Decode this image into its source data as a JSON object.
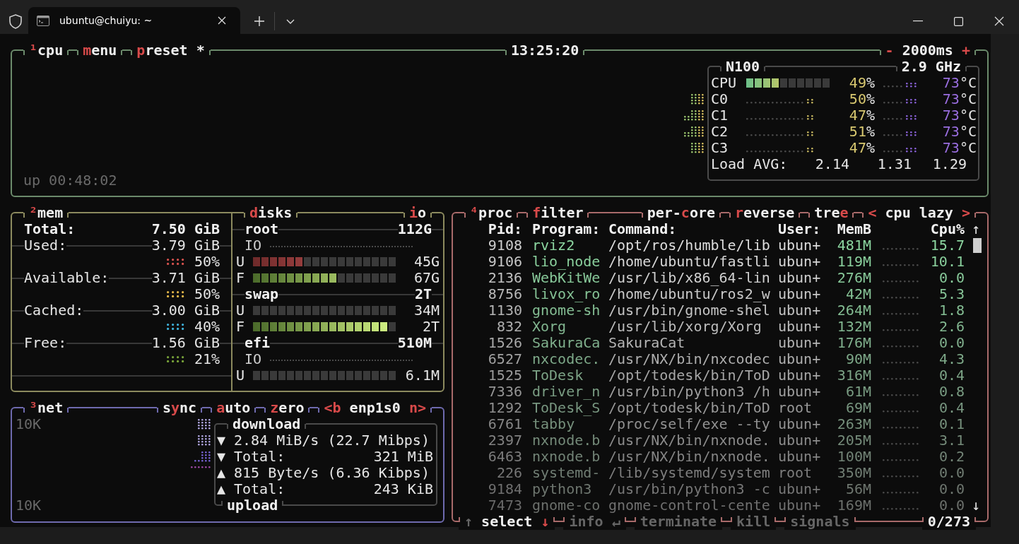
{
  "window": {
    "tab_title": "ubuntu@chuiyu: ~"
  },
  "cpu": {
    "header": {
      "left": [
        {
          "parts": [
            {
              "text": "¹",
              "hot": true
            },
            {
              "text": "cpu",
              "hot": false
            }
          ]
        },
        {
          "parts": [
            {
              "text": "m",
              "hot": true
            },
            {
              "text": "enu",
              "hot": false
            }
          ]
        },
        {
          "parts": [
            {
              "text": "p",
              "hot": true
            },
            {
              "text": "reset *",
              "hot": false
            }
          ]
        }
      ],
      "center": [
        {
          "parts": [
            {
              "text": "13:25:20",
              "hot": false
            }
          ]
        }
      ],
      "right": [
        {
          "parts": [
            {
              "text": "-",
              "hot": true
            },
            {
              "text": " 2000ms ",
              "hot": false
            },
            {
              "text": "+",
              "hot": true
            }
          ]
        }
      ]
    },
    "uptime": "up 00:48:02",
    "info_header": {
      "left": [
        {
          "parts": [
            {
              "text": "N100",
              "hot": false
            }
          ]
        }
      ],
      "right": [
        {
          "parts": [
            {
              "text": "2.9 GHz",
              "hot": false
            }
          ]
        }
      ]
    },
    "total": {
      "label": "CPU",
      "level": 0.4,
      "usage": [
        "49",
        "%"
      ],
      "temp": [
        "73",
        "°C"
      ]
    },
    "cores": [
      {
        "label": "C0",
        "usage": [
          "50",
          "%"
        ],
        "temp": [
          "73",
          "°C"
        ]
      },
      {
        "label": "C1",
        "usage": [
          "47",
          "%"
        ],
        "temp": [
          "73",
          "°C"
        ]
      },
      {
        "label": "C2",
        "usage": [
          "51",
          "%"
        ],
        "temp": [
          "73",
          "°C"
        ]
      },
      {
        "label": "C3",
        "usage": [
          "47",
          "%"
        ],
        "temp": [
          "73",
          "°C"
        ]
      }
    ],
    "load": {
      "label": "Load AVG:",
      "values": [
        "2.14",
        "1.31",
        "1.29"
      ]
    }
  },
  "mem": {
    "header": {
      "left": [
        {
          "parts": [
            {
              "text": "²",
              "hot": true
            },
            {
              "text": "mem",
              "hot": false
            }
          ]
        }
      ]
    },
    "total": {
      "label": "Total:",
      "value": "7.50 GiB"
    },
    "items": [
      {
        "label": "Used:",
        "value": "3.79 GiB",
        "percent": "50%",
        "color": "#d9534f"
      },
      {
        "label": "Available:",
        "value": "3.71 GiB",
        "percent": "50%",
        "color": "#e5b84a"
      },
      {
        "label": "Cached:",
        "value": "3.00 GiB",
        "percent": "40%",
        "color": "#3fb3dc"
      },
      {
        "label": "Free:",
        "value": "1.56 GiB",
        "percent": "21%",
        "color": "#7aa53a"
      }
    ]
  },
  "disks": {
    "header": {
      "left": [
        {
          "parts": [
            {
              "text": "d",
              "hot": true
            },
            {
              "text": "isks",
              "hot": false
            }
          ]
        }
      ],
      "right": [
        {
          "parts": [
            {
              "text": "i",
              "hot": true
            },
            {
              "text": "o",
              "hot": false
            }
          ]
        }
      ]
    },
    "volumes": [
      {
        "name": "root",
        "size": "112G",
        "rows": [
          {
            "kind": "io",
            "label": "IO"
          },
          {
            "kind": "used",
            "label": "U",
            "level": 0.353,
            "value": "45G"
          },
          {
            "kind": "free",
            "label": "F",
            "level": 0.588,
            "value": "67G"
          }
        ]
      },
      {
        "name": "swap",
        "size": "2T",
        "rows": [
          {
            "kind": "used",
            "label": "U",
            "value": "34M"
          },
          {
            "kind": "free",
            "label": "F",
            "level": 0.941,
            "value": "2T"
          }
        ]
      },
      {
        "name": "efi",
        "size": "510M",
        "rows": [
          {
            "kind": "io",
            "label": "IO"
          },
          {
            "kind": "used",
            "label": "U",
            "value": "6.1M"
          }
        ]
      }
    ]
  },
  "net": {
    "header": {
      "left": [
        {
          "parts": [
            {
              "text": "³",
              "hot": true
            },
            {
              "text": "net",
              "hot": false
            }
          ]
        }
      ],
      "right": [
        {
          "parts": [
            {
              "text": "s",
              "hot": false
            },
            {
              "text": "y",
              "hot": true
            },
            {
              "text": "nc",
              "hot": false
            }
          ]
        },
        {
          "parts": [
            {
              "text": "a",
              "hot": true
            },
            {
              "text": "uto",
              "hot": false
            }
          ]
        },
        {
          "parts": [
            {
              "text": "z",
              "hot": true
            },
            {
              "text": "ero",
              "hot": false
            }
          ]
        },
        {
          "parts": [
            {
              "text": "<b",
              "hot": true
            },
            {
              "text": " enp1s0 ",
              "hot": false
            },
            {
              "text": "n>",
              "hot": true
            }
          ]
        }
      ]
    },
    "scale_top": "10K",
    "scale_bottom": "10K",
    "stats_header": {
      "left": [
        {
          "parts": [
            {
              "text": "download",
              "hot": false
            }
          ]
        }
      ]
    },
    "stats_footer": {
      "left": [
        {
          "parts": [
            {
              "text": "upload",
              "hot": false
            }
          ]
        }
      ]
    },
    "stats": [
      {
        "arrow": "▼",
        "text": "2.84 MiB/s (22.7 Mibps)"
      },
      {
        "arrow": "▼",
        "text": "Total:",
        "value": "321 MiB"
      },
      {
        "arrow": "▲",
        "text": "815 Byte/s (6.36 Kibps)"
      },
      {
        "arrow": "▲",
        "text": "Total:",
        "value": "243 KiB"
      }
    ]
  },
  "proc": {
    "header": {
      "left": [
        {
          "parts": [
            {
              "text": "⁴",
              "hot": true
            },
            {
              "text": "proc",
              "hot": false
            }
          ]
        },
        {
          "parts": [
            {
              "text": "f",
              "hot": true
            },
            {
              "text": "ilter",
              "hot": false
            }
          ]
        }
      ],
      "right": [
        {
          "parts": [
            {
              "text": "per-",
              "hot": false
            },
            {
              "text": "c",
              "hot": true
            },
            {
              "text": "ore",
              "hot": false
            }
          ]
        },
        {
          "parts": [
            {
              "text": "r",
              "hot": true
            },
            {
              "text": "everse",
              "hot": false
            }
          ]
        },
        {
          "parts": [
            {
              "text": "tre",
              "hot": false
            },
            {
              "text": "e",
              "hot": true
            }
          ]
        },
        {
          "parts": [
            {
              "text": "<",
              "hot": true
            },
            {
              "text": " cpu lazy ",
              "hot": false
            },
            {
              "text": ">",
              "hot": true
            }
          ]
        }
      ]
    },
    "columns": [
      "Pid:",
      "Program:",
      "Command:",
      "User:",
      "MemB",
      "Cpu%"
    ],
    "scroll_up": "↑",
    "scroll_down": "↓",
    "rows": [
      {
        "pid": "9108",
        "program": "rviz2",
        "command": "/opt/ros/humble/lib",
        "user": "ubun+",
        "mem": "481M",
        "cpu": "15.7"
      },
      {
        "pid": "9106",
        "program": "lio_node",
        "command": "/home/ubuntu/fastli",
        "user": "ubun+",
        "mem": "119M",
        "cpu": "10.1"
      },
      {
        "pid": "2136",
        "program": "WebKitWe",
        "command": "/usr/lib/x86_64-lin",
        "user": "ubun+",
        "mem": "276M",
        "cpu": "0.0"
      },
      {
        "pid": "8756",
        "program": "livox_ro",
        "command": "/home/ubuntu/ros2_w",
        "user": "ubun+",
        "mem": "42M",
        "cpu": "5.3"
      },
      {
        "pid": "1130",
        "program": "gnome-sh",
        "command": "/usr/bin/gnome-shel",
        "user": "ubun+",
        "mem": "264M",
        "cpu": "1.8"
      },
      {
        "pid": "832",
        "program": "Xorg",
        "command": "/usr/lib/xorg/Xorg",
        "user": "ubun+",
        "mem": "132M",
        "cpu": "2.6"
      },
      {
        "pid": "1526",
        "program": "SakuraCa",
        "command": "SakuraCat",
        "user": "ubun+",
        "mem": "176M",
        "cpu": "0.0"
      },
      {
        "pid": "6527",
        "program": "nxcodec.",
        "command": "/usr/NX/bin/nxcodec",
        "user": "ubun+",
        "mem": "90M",
        "cpu": "4.3"
      },
      {
        "pid": "1525",
        "program": "ToDesk",
        "command": "/opt/todesk/bin/ToD",
        "user": "ubun+",
        "mem": "316M",
        "cpu": "0.4"
      },
      {
        "pid": "7336",
        "program": "driver_n",
        "command": "/usr/bin/python3 /h",
        "user": "ubun+",
        "mem": "61M",
        "cpu": "0.8"
      },
      {
        "pid": "1292",
        "program": "ToDesk_S",
        "command": "/opt/todesk/bin/ToD",
        "user": "root",
        "mem": "69M",
        "cpu": "0.4"
      },
      {
        "pid": "6761",
        "program": "tabby",
        "command": "/proc/self/exe --ty",
        "user": "ubun+",
        "mem": "263M",
        "cpu": "0.1"
      },
      {
        "pid": "2397",
        "program": "nxnode.b",
        "command": "/usr/NX/bin/nxnode.",
        "user": "ubun+",
        "mem": "205M",
        "cpu": "3.1"
      },
      {
        "pid": "6463",
        "program": "nxnode.b",
        "command": "/usr/NX/bin/nxnode.",
        "user": "ubun+",
        "mem": "100M",
        "cpu": "0.2"
      },
      {
        "pid": "226",
        "program": "systemd-",
        "command": "/lib/systemd/system",
        "user": "root",
        "mem": "350M",
        "cpu": "0.0"
      },
      {
        "pid": "9184",
        "program": "python3",
        "command": "/usr/bin/python3 -c",
        "user": "ubun+",
        "mem": "56M",
        "cpu": "0.0"
      },
      {
        "pid": "7473",
        "program": "gnome-co",
        "command": "gnome-control-cente",
        "user": "ubun+",
        "mem": "169M",
        "cpu": "0.0"
      }
    ],
    "footer": {
      "left": [
        {
          "parts": [
            {
              "text": "↑",
              "hot": false,
              "dim": true
            },
            {
              "text": " select ",
              "hot": false,
              "dim": false
            },
            {
              "text": "↓",
              "hot": true,
              "dim": false
            }
          ]
        },
        {
          "parts": [
            {
              "text": "info ↵",
              "hot": false,
              "dim": true
            }
          ]
        },
        {
          "parts": [
            {
              "text": "terminate",
              "hot": false,
              "dim": true
            }
          ]
        },
        {
          "parts": [
            {
              "text": "kill",
              "hot": false,
              "dim": true
            }
          ]
        },
        {
          "parts": [
            {
              "text": "signals",
              "hot": false,
              "dim": true
            }
          ]
        }
      ],
      "right": [
        {
          "parts": [
            {
              "text": "0/273",
              "hot": false,
              "dim": false
            }
          ]
        }
      ]
    }
  }
}
